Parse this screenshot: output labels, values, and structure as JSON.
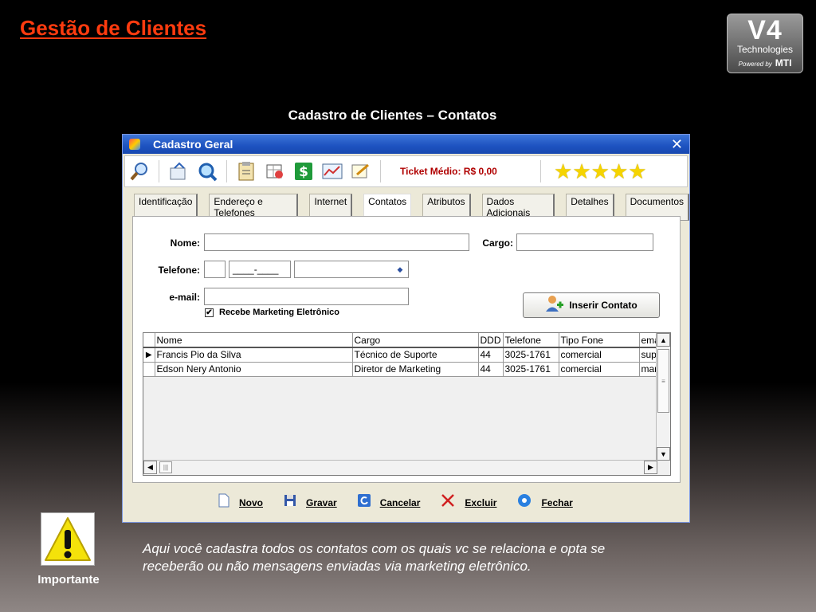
{
  "slide": {
    "title": "Gestão de Clientes",
    "subtitle": "Cadastro de Clientes – Contatos",
    "logo": {
      "main": "V4",
      "line": "Technologies",
      "powered": "Powered by",
      "brand": "MTI"
    }
  },
  "window": {
    "title": "Cadastro Geral",
    "close": "✕",
    "ticket": "Ticket Médio: R$ 0,00",
    "rating": 5
  },
  "toolbar": {
    "icons": [
      "search-icon",
      "open-folder-icon",
      "zoom-icon",
      "clipboard-icon",
      "grid-chart-icon",
      "dollar-icon",
      "chart-icon",
      "edit-icon"
    ]
  },
  "tabs": [
    "Identificação",
    "Endereço e Telefones",
    "Internet",
    "Contatos",
    "Atributos",
    "Dados Adicionais",
    "Detalhes",
    "Documentos"
  ],
  "form": {
    "nome_label": "Nome:",
    "cargo_label": "Cargo:",
    "telefone_label": "Telefone:",
    "email_label": "e-mail:",
    "phone_mask": "____-____",
    "marketing_label": "Recebe Marketing Eletrônico",
    "marketing_checked": "✔",
    "insert_button": "Inserir Contato"
  },
  "grid": {
    "columns": [
      "Nome",
      "Cargo",
      "DDD",
      "Telefone",
      "Tipo Fone",
      "ema"
    ],
    "rows": [
      [
        "Francis Pio da Silva",
        "Técnico de Suporte",
        "44",
        "3025-1761",
        "comercial",
        "sup"
      ],
      [
        "Edson Nery Antonio",
        "Diretor de Marketing",
        "44",
        "3025-1761",
        "comercial",
        "mar"
      ]
    ],
    "current_indicator": "▶"
  },
  "actions": {
    "novo": "Novo",
    "gravar": "Gravar",
    "cancelar": "Cancelar",
    "excluir": "Excluir",
    "fechar": "Fechar"
  },
  "callout": {
    "label": "Importante",
    "text": "Aqui você cadastra todos os contatos com os quais vc se relaciona e opta se receberão ou não mensagens enviadas via marketing eletrônico."
  },
  "colors": {
    "title": "#ff3b0f",
    "titlebar": "#1d52c0",
    "ticket": "#b00000",
    "star": "#f5d400"
  }
}
